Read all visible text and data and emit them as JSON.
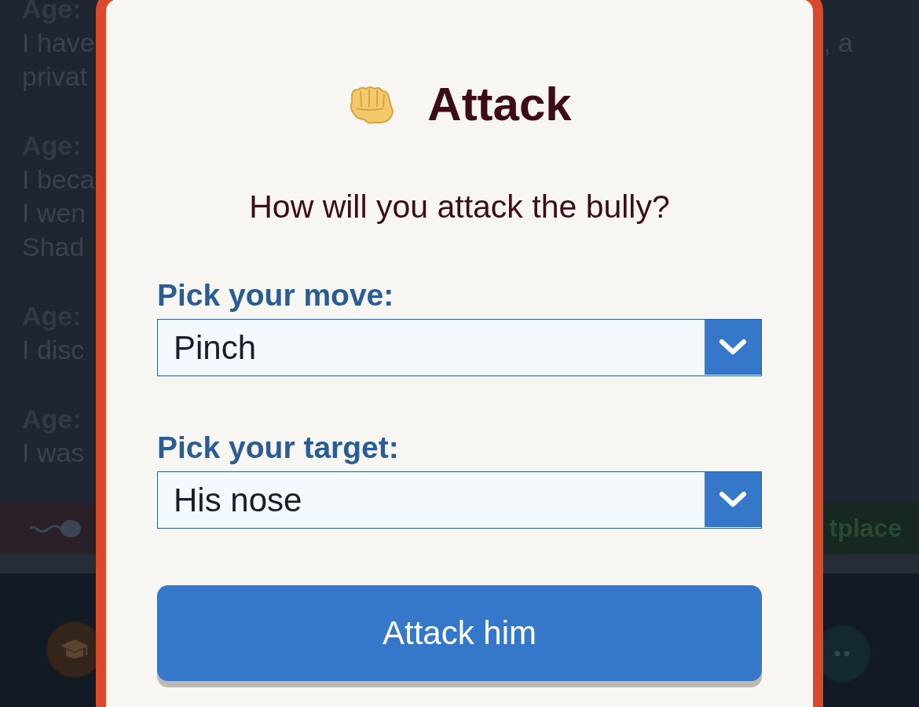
{
  "story": {
    "entries": [
      {
        "heading": "Age:",
        "lines": [
          {
            "text": "I have",
            "end": ", a"
          },
          {
            "text": "privat"
          }
        ]
      },
      {
        "heading": "Age:",
        "lines": [
          {
            "text": "I beca"
          },
          {
            "text": "I wen"
          },
          {
            "text": "Shad"
          }
        ]
      },
      {
        "heading": "Age:",
        "lines": [
          {
            "text": "I disc"
          }
        ]
      },
      {
        "heading": "Age:",
        "lines": [
          {
            "text": "I was"
          }
        ]
      }
    ]
  },
  "ribbon": {
    "right_label": "tplace"
  },
  "modal": {
    "title": "Attack",
    "prompt": "How will you attack the bully?",
    "fields": [
      {
        "label": "Pick your move:",
        "value": "Pinch"
      },
      {
        "label": "Pick your target:",
        "value": "His nose"
      }
    ],
    "submit_button": "Attack him"
  }
}
